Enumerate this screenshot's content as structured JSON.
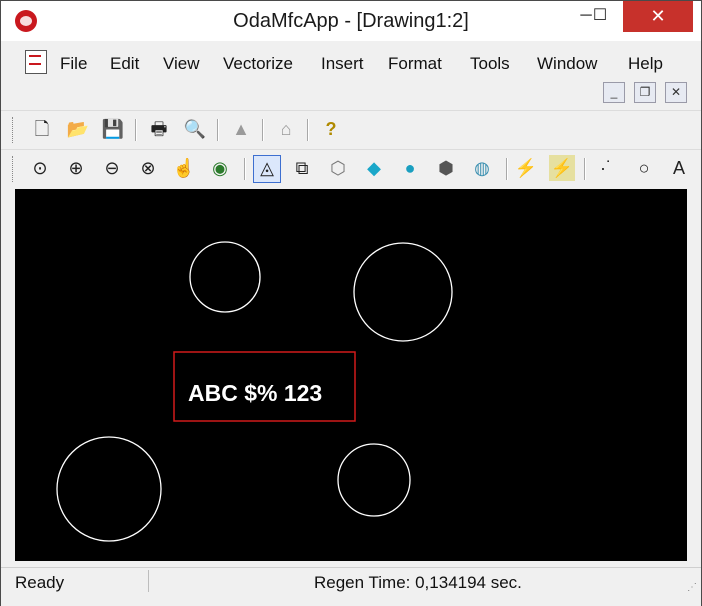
{
  "window": {
    "title": "OdaMfcApp - [Drawing1:2]",
    "controls": {
      "minimize": "─",
      "maximize": "☐",
      "close": "✕"
    }
  },
  "menubar": {
    "items": [
      "File",
      "Edit",
      "View",
      "Vectorize",
      "Insert",
      "Format",
      "Tools",
      "Window",
      "Help"
    ],
    "mdi_controls": {
      "minimize": "_",
      "restore": "❐",
      "close": "✕"
    }
  },
  "toolbar1": {
    "buttons": [
      {
        "icon": "new-document-icon",
        "glyph": "🗋"
      },
      {
        "icon": "open-folder-icon",
        "glyph": "📂"
      },
      {
        "icon": "save-disk-icon",
        "glyph": "💾"
      },
      {
        "icon": "print-icon",
        "glyph": "🖶"
      },
      {
        "icon": "print-preview-icon",
        "glyph": "🔍"
      },
      {
        "icon": "filter-icon",
        "glyph": "▲"
      },
      {
        "icon": "home-icon",
        "glyph": "⌂"
      },
      {
        "icon": "help-icon",
        "glyph": "?"
      }
    ]
  },
  "toolbar2": {
    "buttons": [
      {
        "icon": "zoom-window-icon",
        "glyph": "⊙"
      },
      {
        "icon": "zoom-in-icon",
        "glyph": "⊕"
      },
      {
        "icon": "zoom-out-icon",
        "glyph": "⊖"
      },
      {
        "icon": "zoom-extents-icon",
        "glyph": "⊗"
      },
      {
        "icon": "pan-icon",
        "glyph": "☝"
      },
      {
        "icon": "orbit-icon",
        "glyph": "◉"
      },
      {
        "icon": "2d-wireframe-icon",
        "glyph": "◬"
      },
      {
        "icon": "3d-wireframe-icon",
        "glyph": "⧉"
      },
      {
        "icon": "hidden-line-icon",
        "glyph": "⬡"
      },
      {
        "icon": "flat-shaded-icon",
        "glyph": "◆"
      },
      {
        "icon": "gouraud-shaded-icon",
        "glyph": "●"
      },
      {
        "icon": "flat-edges-icon",
        "glyph": "⬢"
      },
      {
        "icon": "gouraud-edges-icon",
        "glyph": "◍"
      },
      {
        "icon": "regen-icon",
        "glyph": "⚡"
      },
      {
        "icon": "regen-all-icon",
        "glyph": "⚡"
      },
      {
        "icon": "point-icon",
        "glyph": "·˙"
      },
      {
        "icon": "circle-icon",
        "glyph": "○"
      },
      {
        "icon": "text-icon",
        "glyph": "A"
      }
    ]
  },
  "drawing": {
    "text": "ABC $% 123",
    "background": "#000000",
    "stroke": "#ffffff",
    "highlight": "#d11a1a"
  },
  "status": {
    "ready": "Ready",
    "regen": "Regen Time: 0,134194 sec."
  }
}
